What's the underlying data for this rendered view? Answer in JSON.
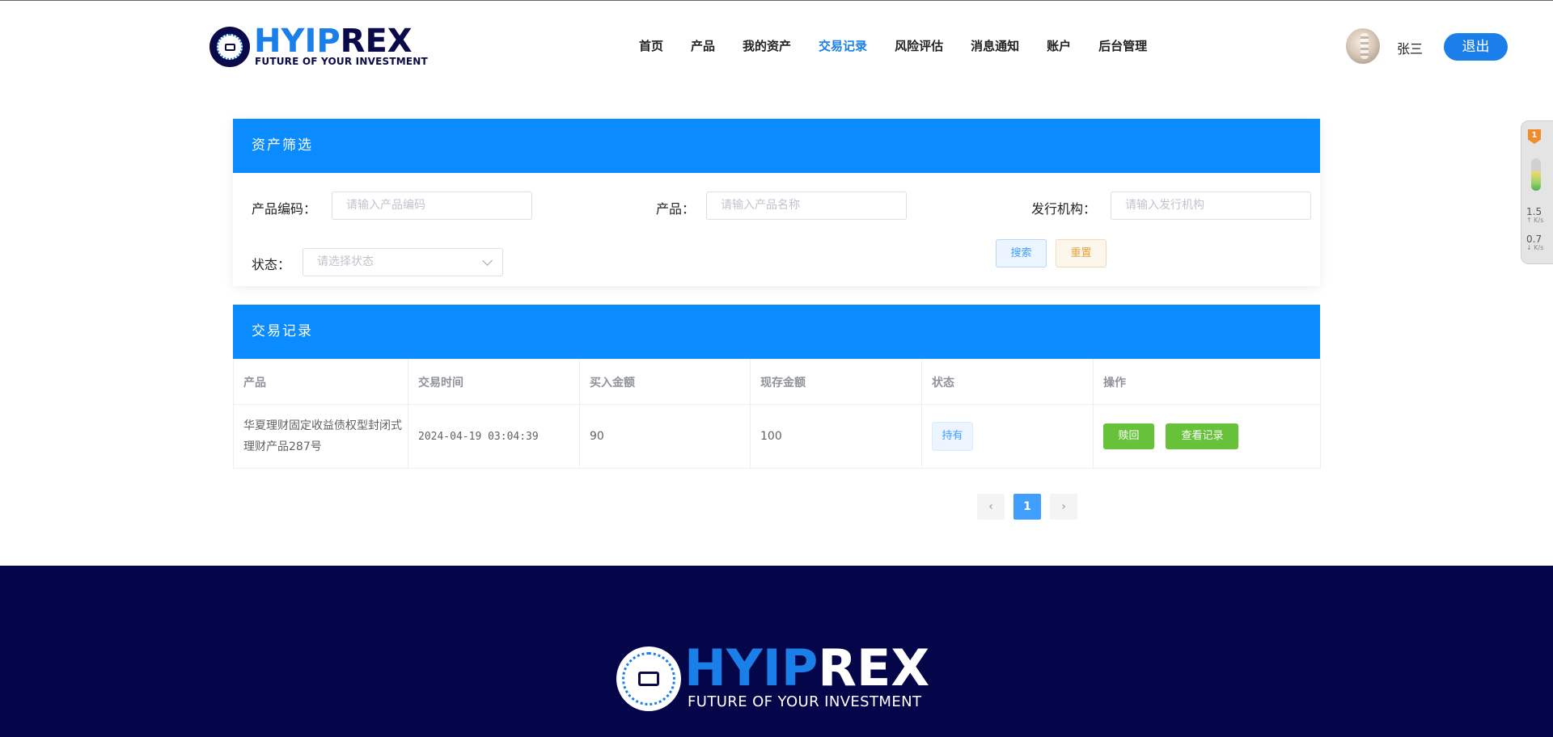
{
  "header": {
    "logo": {
      "part1": "HYIP",
      "part2": "REX",
      "tagline": "FUTURE OF YOUR INVESTMENT"
    },
    "nav": [
      {
        "label": "首页",
        "active": false
      },
      {
        "label": "产品",
        "active": false
      },
      {
        "label": "我的资产",
        "active": false
      },
      {
        "label": "交易记录",
        "active": true
      },
      {
        "label": "风险评估",
        "active": false
      },
      {
        "label": "消息通知",
        "active": false
      },
      {
        "label": "账户",
        "active": false
      },
      {
        "label": "后台管理",
        "active": false
      }
    ],
    "username": "张三",
    "logout_label": "退出"
  },
  "side_widget": {
    "badge": "1",
    "upload_speed": "1.5",
    "download_speed": "0.7",
    "unit": "K/s"
  },
  "filter": {
    "title": "资产筛选",
    "code_label": "产品编码：",
    "code_placeholder": "请输入产品编码",
    "product_label": "产品：",
    "product_placeholder": "请输入产品名称",
    "issuer_label": "发行机构：",
    "issuer_placeholder": "请输入发行机构",
    "status_label": "状态：",
    "status_placeholder": "请选择状态",
    "search_label": "搜索",
    "reset_label": "重置"
  },
  "records": {
    "title": "交易记录",
    "columns": [
      "产品",
      "交易时间",
      "买入金额",
      "现存金额",
      "状态",
      "操作"
    ],
    "rows": [
      {
        "product": "华夏理财固定收益债权型封闭式理财产品287号",
        "time": "2024-04-19 03:04:39",
        "buy_amount": "90",
        "current_amount": "100",
        "status": "持有",
        "redeem_label": "赎回",
        "view_label": "查看记录"
      }
    ]
  },
  "pagination": {
    "prev": "‹",
    "current": "1",
    "next": "›"
  },
  "footer": {
    "logo": {
      "part1": "HYIP",
      "part2": "REX",
      "tagline": "FUTURE OF YOUR INVESTMENT"
    }
  },
  "colors": {
    "primary": "#0a8bff",
    "brand_blue": "#1a7fe8",
    "navy": "#05054a",
    "success": "#67c23a",
    "warning": "#e6a23c"
  }
}
